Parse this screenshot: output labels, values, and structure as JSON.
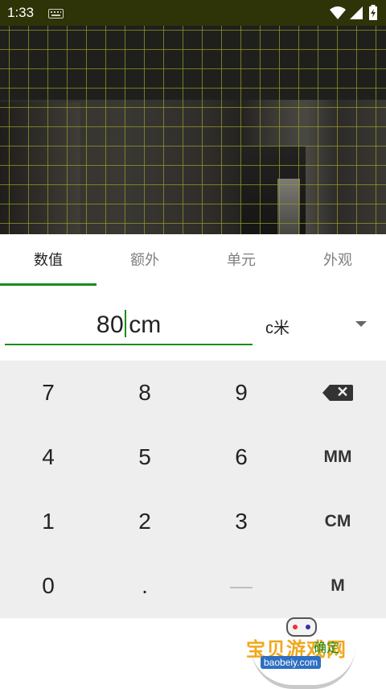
{
  "status_bar": {
    "time": "1:33",
    "icons": [
      "keyboard-icon",
      "wifi-icon",
      "signal-icon",
      "battery-icon"
    ]
  },
  "tabs": [
    {
      "label": "数值",
      "active": true
    },
    {
      "label": "额外",
      "active": false
    },
    {
      "label": "单元",
      "active": false
    },
    {
      "label": "外观",
      "active": false
    }
  ],
  "input": {
    "value": "80",
    "unit_suffix": "cm",
    "unit_select": "c米"
  },
  "keypad": {
    "rows": [
      [
        "7",
        "8",
        "9",
        "backspace"
      ],
      [
        "4",
        "5",
        "6",
        "MM"
      ],
      [
        "1",
        "2",
        "3",
        "CM"
      ],
      [
        "0",
        ".",
        "—",
        "M"
      ]
    ]
  },
  "watermark": {
    "text": "宝贝游戏网",
    "url": "baobeiy.com",
    "confirm": "确定"
  },
  "colors": {
    "accent": "#1b8c1b",
    "status_bar": "#2f3308",
    "keypad_bg": "#eeeeee"
  }
}
